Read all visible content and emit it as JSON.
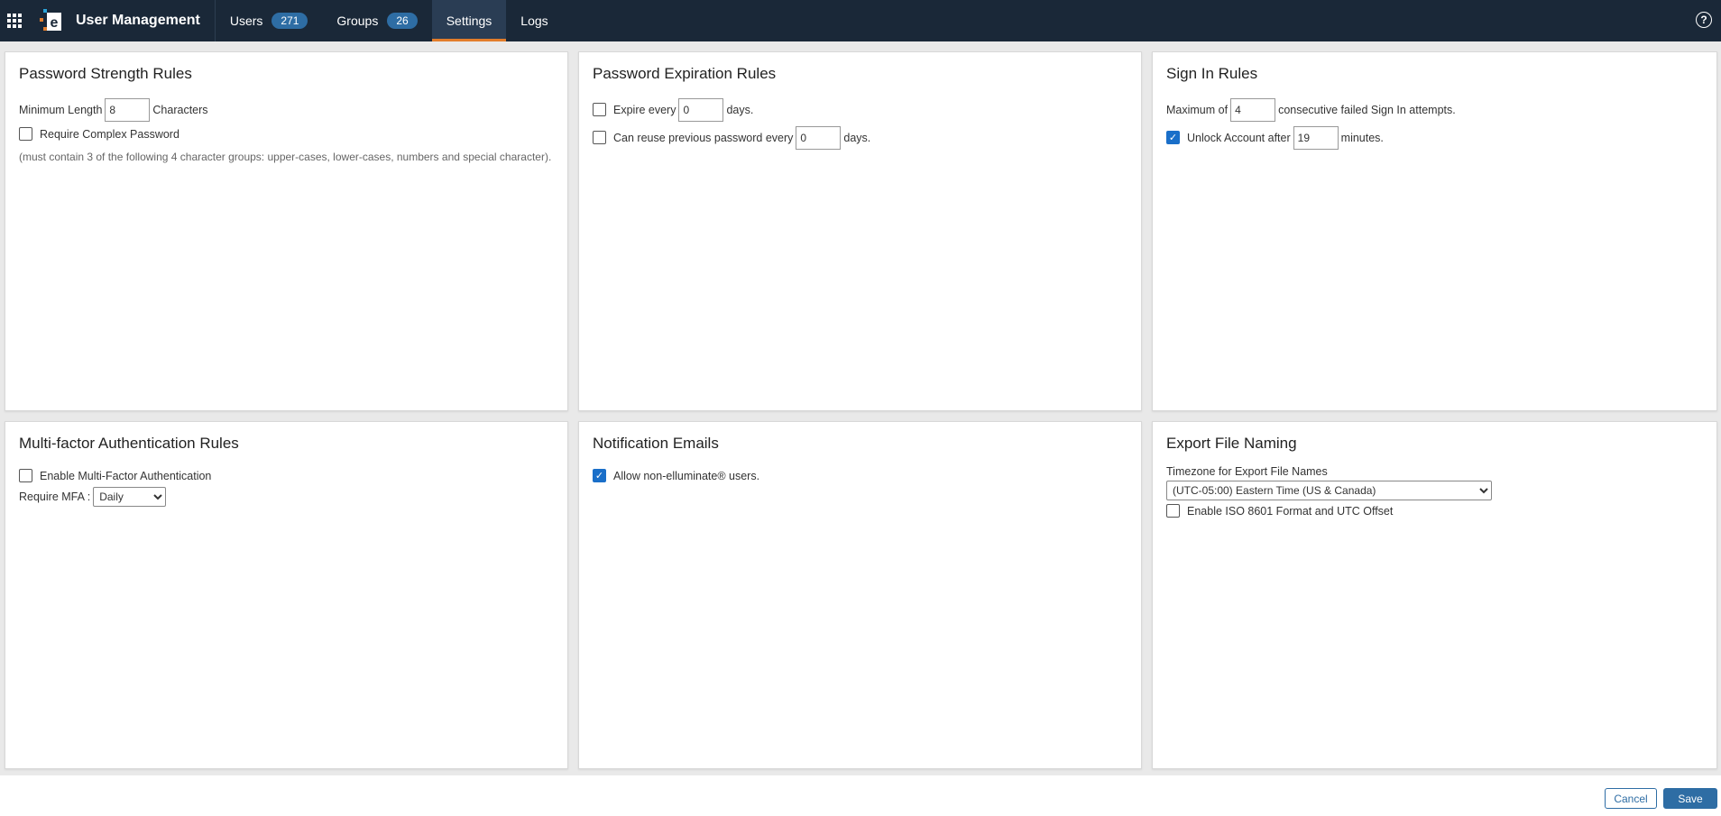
{
  "header": {
    "app_title": "User Management",
    "tabs": [
      {
        "label": "Users",
        "badge": "271"
      },
      {
        "label": "Groups",
        "badge": "26"
      },
      {
        "label": "Settings"
      },
      {
        "label": "Logs"
      }
    ],
    "help_glyph": "?"
  },
  "password_strength": {
    "title": "Password Strength Rules",
    "min_length_label": "Minimum Length",
    "min_length_value": "8",
    "min_length_suffix": "Characters",
    "complex_label": "Require Complex Password",
    "complex_checked": false,
    "hint": "(must contain 3 of the following 4 character groups: upper-cases, lower-cases, numbers and special character)."
  },
  "password_expiration": {
    "title": "Password Expiration Rules",
    "expire_label": "Expire every",
    "expire_value": "0",
    "expire_suffix": "days.",
    "expire_checked": false,
    "reuse_label": "Can reuse previous password every",
    "reuse_value": "0",
    "reuse_suffix": "days.",
    "reuse_checked": false
  },
  "sign_in": {
    "title": "Sign In Rules",
    "max_label": "Maximum of",
    "max_value": "4",
    "max_suffix": "consecutive failed Sign In attempts.",
    "unlock_label": "Unlock Account after",
    "unlock_value": "19",
    "unlock_suffix": "minutes.",
    "unlock_checked": true
  },
  "mfa": {
    "title": "Multi-factor Authentication Rules",
    "enable_label": "Enable Multi-Factor Authentication",
    "enable_checked": false,
    "require_label": "Require MFA :",
    "require_value": "Daily"
  },
  "notification": {
    "title": "Notification Emails",
    "allow_label": "Allow non-elluminate® users.",
    "allow_checked": true
  },
  "export": {
    "title": "Export File Naming",
    "timezone_label": "Timezone for Export File Names",
    "timezone_value": "(UTC-05:00) Eastern Time (US & Canada)",
    "iso_label": "Enable ISO 8601 Format and UTC Offset",
    "iso_checked": false
  },
  "footer": {
    "cancel_label": "Cancel",
    "save_label": "Save"
  },
  "colors": {
    "topbar": "#1a2838",
    "accent": "#2e6da4",
    "active_underline": "#e27d2b",
    "checkbox_on": "#1a6fc9"
  }
}
